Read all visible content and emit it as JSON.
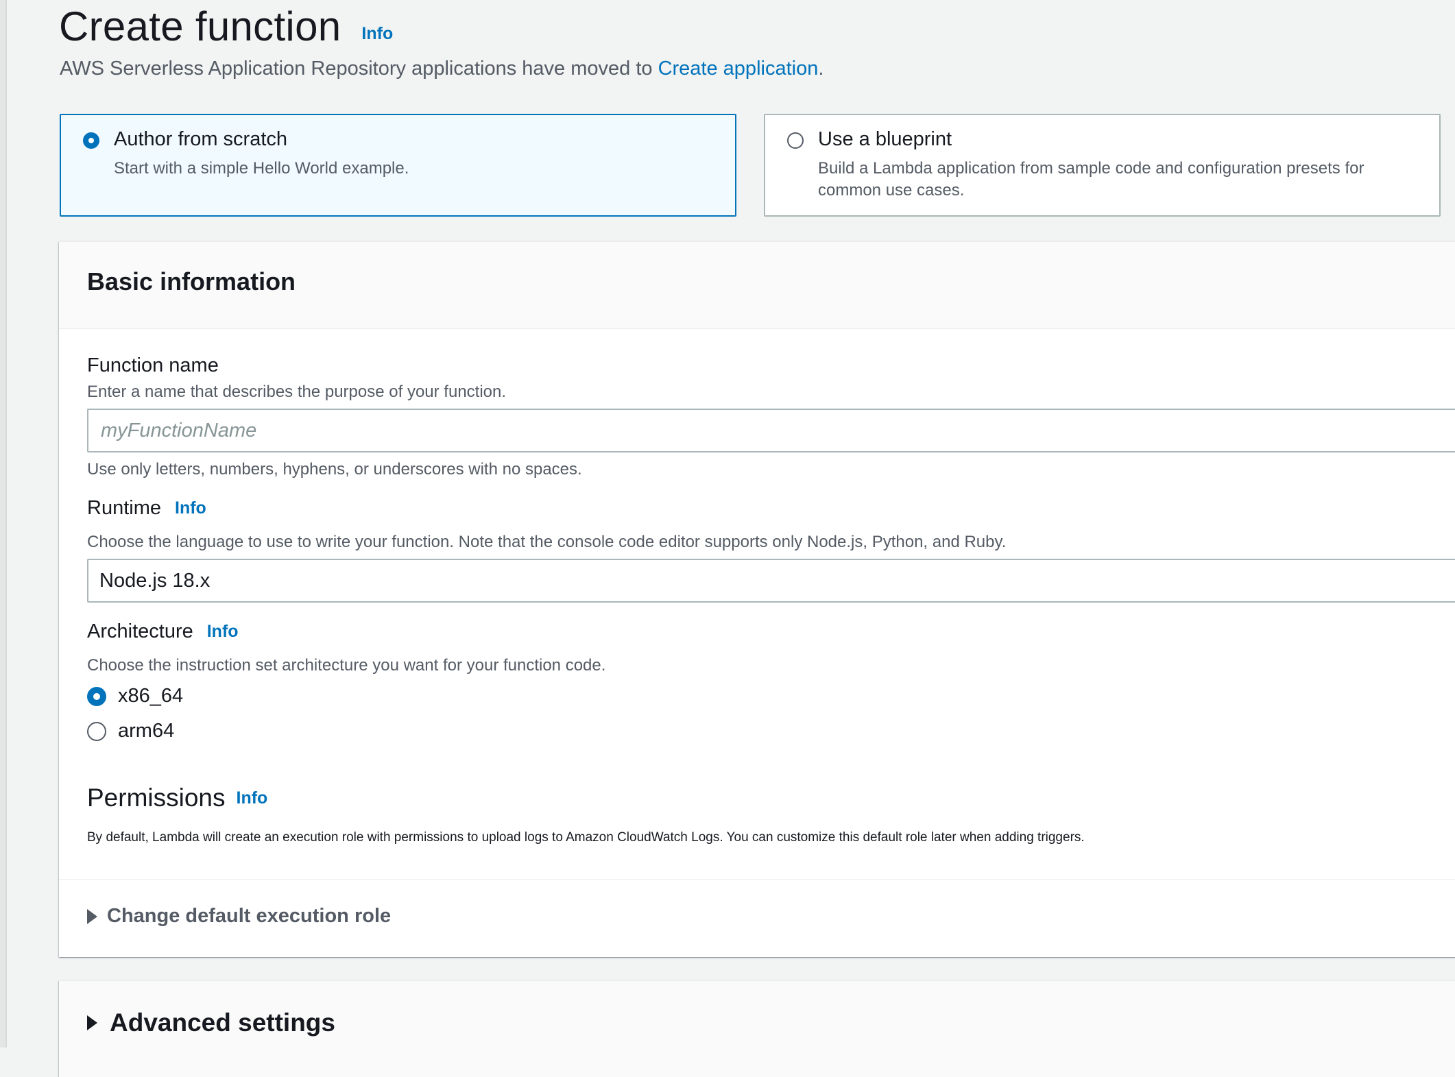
{
  "header": {
    "title": "Create function",
    "info": "Info",
    "subtitle_prefix": "AWS Serverless Application Repository applications have moved to ",
    "subtitle_link": "Create application",
    "subtitle_suffix": "."
  },
  "options": [
    {
      "title": "Author from scratch",
      "description": "Start with a simple Hello World example.",
      "selected": true
    },
    {
      "title": "Use a blueprint",
      "description": "Build a Lambda application from sample code and configuration presets for common use cases.",
      "selected": false
    }
  ],
  "basic_info": {
    "heading": "Basic information",
    "function_name": {
      "label": "Function name",
      "description": "Enter a name that describes the purpose of your function.",
      "placeholder": "myFunctionName",
      "value": "",
      "hint": "Use only letters, numbers, hyphens, or underscores with no spaces."
    },
    "runtime": {
      "label": "Runtime",
      "info": "Info",
      "description": "Choose the language to use to write your function. Note that the console code editor supports only Node.js, Python, and Ruby.",
      "value": "Node.js 18.x"
    },
    "architecture": {
      "label": "Architecture",
      "info": "Info",
      "description": "Choose the instruction set architecture you want for your function code.",
      "options": [
        {
          "label": "x86_64",
          "selected": true
        },
        {
          "label": "arm64",
          "selected": false
        }
      ]
    },
    "permissions": {
      "title": "Permissions",
      "info": "Info",
      "description": "By default, Lambda will create an execution role with permissions to upload logs to Amazon CloudWatch Logs. You can customize this default role later when adding triggers."
    },
    "change_role": "Change default execution role"
  },
  "advanced": {
    "title": "Advanced settings"
  },
  "colors": {
    "link": "#0073bb",
    "selected_bg": "#f1faff",
    "border": "#aab7b8",
    "text": "#16191f",
    "muted": "#545b64"
  }
}
